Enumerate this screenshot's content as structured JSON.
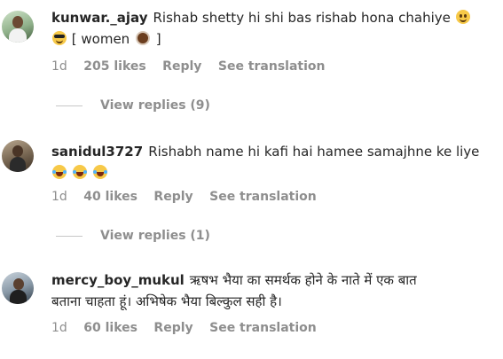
{
  "comments": [
    {
      "username": "kunwar._ajay",
      "text_line1": "Rishab shetty hi shi bas rishab hona chahiye",
      "text_line2_pre": "[ women",
      "text_line2_post": "]",
      "time": "1d",
      "likes": "205 likes",
      "reply": "Reply",
      "translate": "See translation",
      "view_replies": "View replies (9)",
      "avatar_colors": [
        "#a9c7a2",
        "#3f5a3a"
      ]
    },
    {
      "username": "sanidul3727",
      "text_line1": "Rishabh name hi kafi hai hamee samajhne ke liye",
      "time": "1d",
      "likes": "40 likes",
      "reply": "Reply",
      "translate": "See translation",
      "view_replies": "View replies (1)",
      "avatar_colors": [
        "#7b6a55",
        "#3a2e22"
      ]
    },
    {
      "username": "mercy_boy_mukul",
      "text_line1": "ऋषभ भैया का समर्थक होने के नाते में एक बात",
      "text_line2": "बताना चाहता हूं। अभिषेक भैया बिल्कुल सही है।",
      "time": "1d",
      "likes": "60 likes",
      "reply": "Reply",
      "translate": "See translation",
      "avatar_colors": [
        "#8a9aa8",
        "#2e3a46"
      ]
    }
  ],
  "icons": {
    "smile": "slightly-smiling-face-icon",
    "cool": "sunglasses-face-icon",
    "coffee": "hot-beverage-icon",
    "laugh": "tears-of-joy-icon"
  }
}
